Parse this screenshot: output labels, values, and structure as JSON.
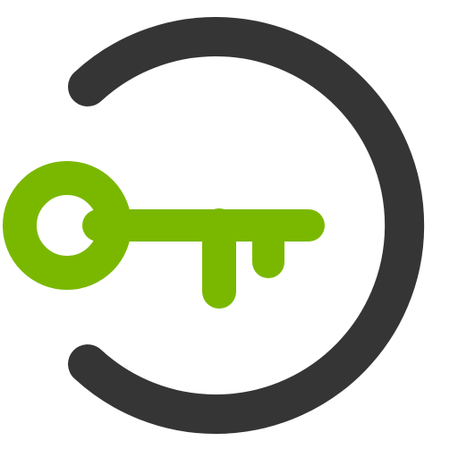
{
  "icon": {
    "name": "key-login-icon",
    "colors": {
      "ring": "#353535",
      "key": "#7ab800",
      "background": "#ffffff"
    }
  }
}
